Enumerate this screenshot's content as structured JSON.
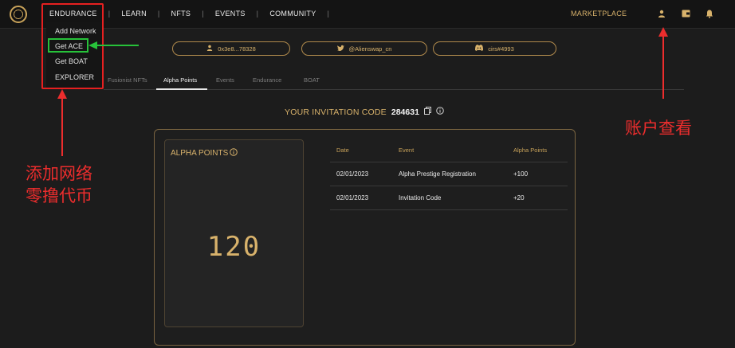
{
  "nav": {
    "items": [
      "ENDURANCE",
      "LEARN",
      "NFTS",
      "EVENTS",
      "COMMUNITY"
    ],
    "marketplace": "MARKETPLACE",
    "icons": [
      "user-icon",
      "wallet-icon",
      "bell-icon"
    ]
  },
  "dropdown": {
    "items": [
      "Add Network",
      "Get ACE",
      "Get BOAT",
      "EXPLORER"
    ],
    "highlighted": "Get ACE"
  },
  "social": {
    "wallet": "0x3e8...78328",
    "twitter": "@Alienswap_cn",
    "discord": "cirs#4993"
  },
  "tabs": {
    "items": [
      "Fusionist NFTs",
      "Alpha Points",
      "Events",
      "Endurance",
      "BOAT"
    ],
    "active": "Alpha Points"
  },
  "invitation": {
    "label": "YOUR INVITATION CODE",
    "code": "284631"
  },
  "points": {
    "title": "ALPHA POINTS",
    "value": "120"
  },
  "table": {
    "headers": [
      "Date",
      "Event",
      "Alpha Points"
    ],
    "rows": [
      [
        "02/01/2023",
        "Alpha Prestige Registration",
        "+100"
      ],
      [
        "02/01/2023",
        "Invitation Code",
        "+20"
      ]
    ]
  },
  "annotations": {
    "left_line1": "添加网络",
    "left_line2": "零撸代币",
    "right": "账户查看"
  },
  "colors": {
    "accent": "#d8b26b",
    "background": "#1c1c1c",
    "annotation_red": "#ec2d2d",
    "annotation_green": "#27c23a"
  }
}
